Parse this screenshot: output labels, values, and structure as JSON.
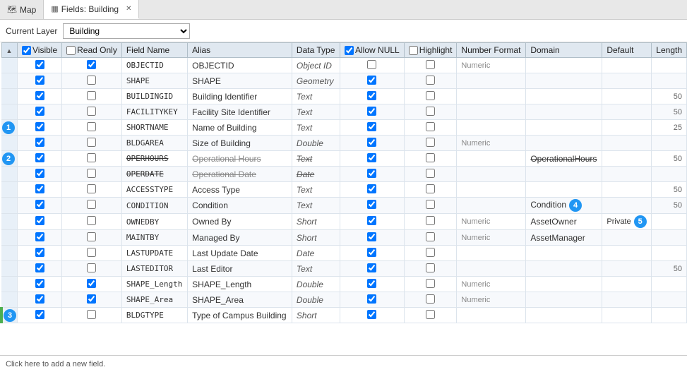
{
  "tabs": [
    {
      "id": "map",
      "label": "Map",
      "icon": "🗺",
      "active": false,
      "closable": false
    },
    {
      "id": "fields-building",
      "label": "Fields: Building",
      "icon": "▦",
      "active": true,
      "closable": true
    }
  ],
  "toolbar": {
    "layer_label": "Current Layer",
    "layer_value": "Building",
    "layer_options": [
      "Building"
    ]
  },
  "table": {
    "columns": [
      {
        "id": "visible",
        "label": "Visible",
        "has_check": true
      },
      {
        "id": "readonly",
        "label": "Read Only",
        "has_check": true
      },
      {
        "id": "fieldname",
        "label": "Field Name"
      },
      {
        "id": "alias",
        "label": "Alias"
      },
      {
        "id": "datatype",
        "label": "Data Type"
      },
      {
        "id": "allownull",
        "label": "Allow NULL",
        "has_check": true
      },
      {
        "id": "highlight",
        "label": "Highlight",
        "has_check": true
      },
      {
        "id": "numberformat",
        "label": "Number Format"
      },
      {
        "id": "domain",
        "label": "Domain"
      },
      {
        "id": "default",
        "label": "Default"
      },
      {
        "id": "length",
        "label": "Length"
      }
    ],
    "rows": [
      {
        "indicator": "",
        "badge": null,
        "green": false,
        "visible": true,
        "readonly": true,
        "fieldname": "OBJECTID",
        "alias": "OBJECTID",
        "datatype": "Object ID",
        "allownull": false,
        "highlight": false,
        "numberformat": "Numeric",
        "domain": "",
        "default_val": "",
        "length": "",
        "strikethrough": false
      },
      {
        "indicator": "",
        "badge": null,
        "green": false,
        "visible": true,
        "readonly": false,
        "fieldname": "SHAPE",
        "alias": "SHAPE",
        "datatype": "Geometry",
        "allownull": true,
        "highlight": false,
        "numberformat": "",
        "domain": "",
        "default_val": "",
        "length": "",
        "strikethrough": false
      },
      {
        "indicator": "",
        "badge": null,
        "green": false,
        "visible": true,
        "readonly": false,
        "fieldname": "BUILDINGID",
        "alias": "Building Identifier",
        "datatype": "Text",
        "allownull": true,
        "highlight": false,
        "numberformat": "",
        "domain": "",
        "default_val": "",
        "length": "50",
        "strikethrough": false
      },
      {
        "indicator": "",
        "badge": null,
        "green": false,
        "visible": true,
        "readonly": false,
        "fieldname": "FACILITYKEY",
        "alias": "Facility Site Identifier",
        "datatype": "Text",
        "allownull": true,
        "highlight": false,
        "numberformat": "",
        "domain": "",
        "default_val": "",
        "length": "50",
        "strikethrough": false
      },
      {
        "indicator": "1",
        "badge": 1,
        "green": false,
        "visible": true,
        "readonly": false,
        "fieldname": "SHORTNAME",
        "alias": "Name of Building",
        "datatype": "Text",
        "allownull": true,
        "highlight": false,
        "numberformat": "",
        "domain": "",
        "default_val": "",
        "length": "25",
        "strikethrough": false
      },
      {
        "indicator": "",
        "badge": null,
        "green": false,
        "visible": true,
        "readonly": false,
        "fieldname": "BLDGAREA",
        "alias": "Size of Building",
        "datatype": "Double",
        "allownull": true,
        "highlight": false,
        "numberformat": "Numeric",
        "domain": "",
        "default_val": "",
        "length": "",
        "strikethrough": false
      },
      {
        "indicator": "2",
        "badge": 2,
        "green": false,
        "visible": true,
        "readonly": false,
        "fieldname": "OPERHOURS",
        "alias": "Operational Hours",
        "datatype": "Text",
        "allownull": true,
        "highlight": false,
        "numberformat": "",
        "domain": "OperationalHours",
        "default_val": "",
        "length": "50",
        "strikethrough": true
      },
      {
        "indicator": "",
        "badge": null,
        "green": false,
        "visible": true,
        "readonly": false,
        "fieldname": "OPERDATE",
        "alias": "Operational Date",
        "datatype": "Date",
        "allownull": true,
        "highlight": false,
        "numberformat": "",
        "domain": "",
        "default_val": "",
        "length": "",
        "strikethrough": true
      },
      {
        "indicator": "",
        "badge": null,
        "green": false,
        "visible": true,
        "readonly": false,
        "fieldname": "ACCESSTYPE",
        "alias": "Access Type",
        "datatype": "Text",
        "allownull": true,
        "highlight": false,
        "numberformat": "",
        "domain": "",
        "default_val": "",
        "length": "50",
        "strikethrough": false
      },
      {
        "indicator": "",
        "badge": null,
        "green": false,
        "visible": true,
        "readonly": false,
        "fieldname": "CONDITION",
        "alias": "Condition",
        "datatype": "Text",
        "allownull": true,
        "highlight": false,
        "numberformat": "",
        "domain": "Condition",
        "default_val": "",
        "length": "50",
        "strikethrough": false
      },
      {
        "indicator": "",
        "badge": null,
        "green": false,
        "visible": true,
        "readonly": false,
        "fieldname": "OWNEDBY",
        "alias": "Owned By",
        "datatype": "Short",
        "allownull": true,
        "highlight": false,
        "numberformat": "Numeric",
        "domain": "AssetOwner",
        "default_val": "Private",
        "length": "",
        "strikethrough": false
      },
      {
        "indicator": "",
        "badge": null,
        "green": false,
        "visible": true,
        "readonly": false,
        "fieldname": "MAINTBY",
        "alias": "Managed By",
        "datatype": "Short",
        "allownull": true,
        "highlight": false,
        "numberformat": "Numeric",
        "domain": "AssetManager",
        "default_val": "",
        "length": "",
        "strikethrough": false
      },
      {
        "indicator": "",
        "badge": null,
        "green": false,
        "visible": true,
        "readonly": false,
        "fieldname": "LASTUPDATE",
        "alias": "Last Update Date",
        "datatype": "Date",
        "allownull": true,
        "highlight": false,
        "numberformat": "",
        "domain": "",
        "default_val": "",
        "length": "",
        "strikethrough": false
      },
      {
        "indicator": "",
        "badge": null,
        "green": false,
        "visible": true,
        "readonly": false,
        "fieldname": "LASTEDITOR",
        "alias": "Last Editor",
        "datatype": "Text",
        "allownull": true,
        "highlight": false,
        "numberformat": "",
        "domain": "",
        "default_val": "",
        "length": "50",
        "strikethrough": false
      },
      {
        "indicator": "",
        "badge": null,
        "green": false,
        "visible": true,
        "readonly": true,
        "fieldname": "SHAPE_Length",
        "alias": "SHAPE_Length",
        "datatype": "Double",
        "allownull": true,
        "highlight": false,
        "numberformat": "Numeric",
        "domain": "",
        "default_val": "",
        "length": "",
        "strikethrough": false
      },
      {
        "indicator": "",
        "badge": null,
        "green": false,
        "visible": true,
        "readonly": true,
        "fieldname": "SHAPE_Area",
        "alias": "SHAPE_Area",
        "datatype": "Double",
        "allownull": true,
        "highlight": false,
        "numberformat": "Numeric",
        "domain": "",
        "default_val": "",
        "length": "",
        "strikethrough": false
      },
      {
        "indicator": "3",
        "badge": 3,
        "green": true,
        "visible": true,
        "readonly": false,
        "fieldname": "BLDGTYPE",
        "alias": "Type of Campus Building",
        "datatype": "Short",
        "allownull": true,
        "highlight": false,
        "numberformat": "",
        "domain": "",
        "default_val": "",
        "length": "",
        "strikethrough": false
      }
    ]
  },
  "badge_labels": {
    "4": "4",
    "5": "5"
  },
  "add_field_text": "Click here to add a new field.",
  "page_title": "Fields: Building"
}
